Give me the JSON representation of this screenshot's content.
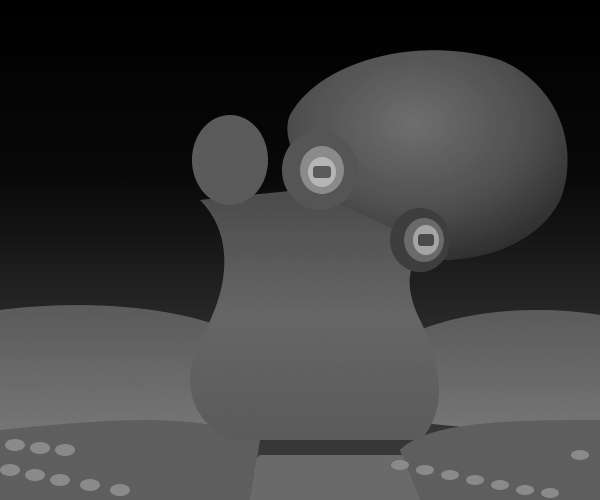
{
  "scene": {
    "subject": "octopus-sculpt",
    "colors": {
      "background_top": "#000000",
      "background_bottom": "#3a3a3a",
      "skin_light": "#7a7a7a",
      "skin_mid": "#555555",
      "skin_dark": "#2a2a2a",
      "floor": "#6a6a6a"
    }
  }
}
